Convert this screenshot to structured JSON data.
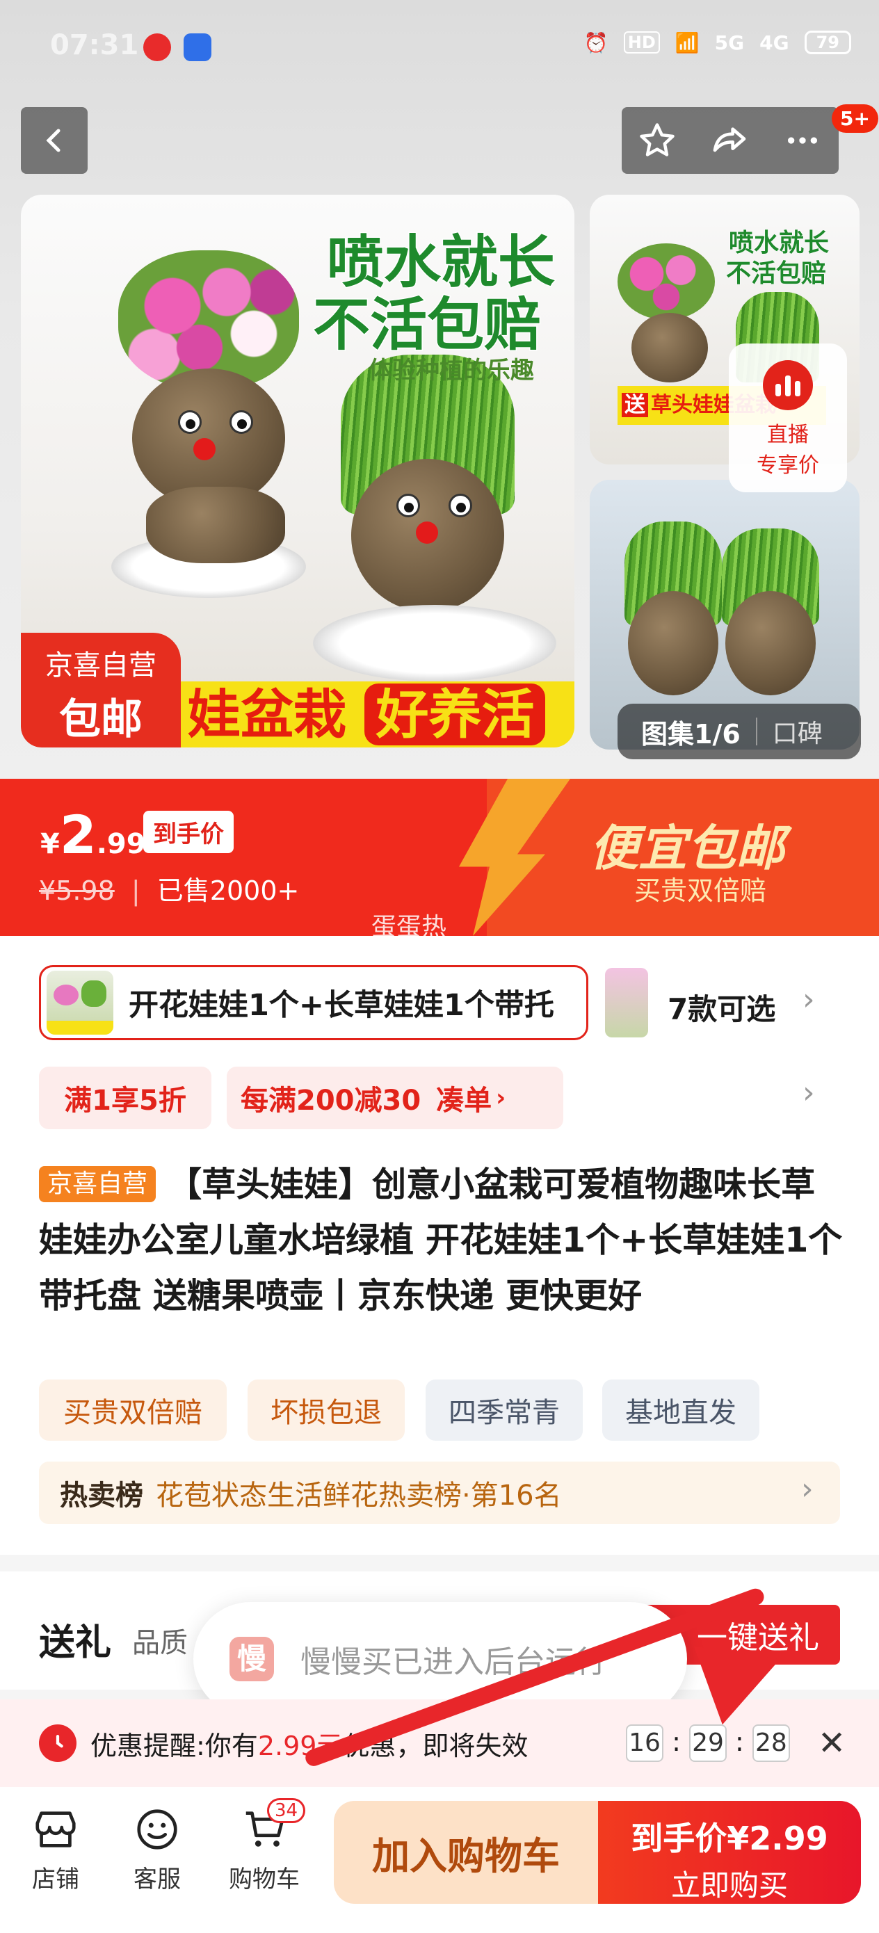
{
  "status_bar": {
    "time": "07:31",
    "network": "5G",
    "network2": "4G",
    "hd": "HD",
    "battery": "79"
  },
  "nav": {
    "back_icon": "chevron-left-icon",
    "favorite_icon": "star-icon",
    "share_icon": "share-icon",
    "more_icon": "more-icon",
    "badge": "5+"
  },
  "gallery": {
    "slogan_line1": "喷水就长",
    "slogan_line2": "不活包赔",
    "slogan_sub": "体验种植的乐趣",
    "jx_label_1": "京喜自营",
    "jx_label_2": "包邮",
    "banner_text": "娃盆栽",
    "banner_highlight": "好养活",
    "thumb_slogan_1": "喷水就长",
    "thumb_slogan_2": "不活包赔",
    "thumb_banner_tag": "送",
    "thumb_banner": "草头娃娃盆栽",
    "live_label_1": "直播",
    "live_label_2": "专享价",
    "counter": "图集1/6",
    "reviews": "口碑"
  },
  "price": {
    "currency": "¥",
    "integer": "2",
    "decimal": ".99",
    "final_label": "到手价",
    "original": "¥5.98",
    "sold": "已售2000+",
    "promo_title": "便宜包邮",
    "promo_sub": "买贵双倍赔",
    "watermark": "蛋蛋热"
  },
  "sku": {
    "selected": "开花娃娃1个+长草娃娃1个带托",
    "options_count": "7款可选"
  },
  "coupons": {
    "c1": "满1享5折",
    "c2": "每满200减30",
    "c2_action": "凑单"
  },
  "product": {
    "store_tag": "京喜自营",
    "title": "【草头娃娃】创意小盆栽可爱植物趣味长草娃娃办公室儿童水培绿植 开花娃娃1个+长草娃娃1个带托盘 送糖果喷壶丨京东快递 更快更好"
  },
  "features": [
    "买贵双倍赔",
    "坏损包退",
    "四季常青",
    "基地直发"
  ],
  "rank": {
    "label": "热卖榜",
    "text": "花苞状态生活鲜花热卖榜·第16名"
  },
  "gift": {
    "title": "送礼",
    "sub": "品质",
    "button": "一键送礼"
  },
  "toast": {
    "icon_char": "慢",
    "text": "慢慢买已进入后台运行"
  },
  "reminder": {
    "label": "优惠提醒:",
    "pre": "你有",
    "amount": "2.99元",
    "post": "优惠，即将失效",
    "h": "16",
    "m": "29",
    "s": "28"
  },
  "bottom": {
    "shop": "店铺",
    "service": "客服",
    "cart": "购物车",
    "cart_count": "34",
    "add_cart": "加入购物车",
    "buy_label": "到手价",
    "buy_price": "¥2.99",
    "buy_now": "立即购买"
  },
  "colors": {
    "brand_red": "#f02a1d",
    "promo_orange": "#f6a52b",
    "jx_orange": "#f5821f"
  }
}
